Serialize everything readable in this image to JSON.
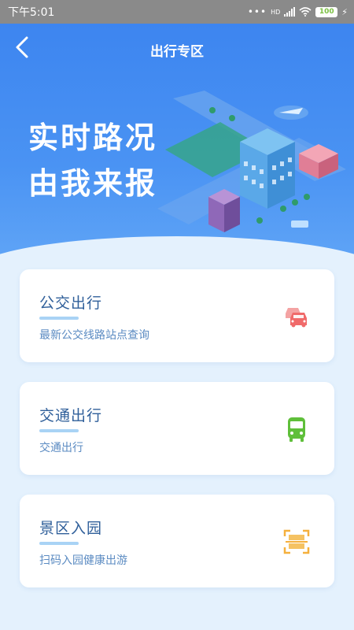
{
  "status_bar": {
    "time": "下午5:01",
    "signal_label": "HD",
    "battery": "100"
  },
  "nav": {
    "title": "出行专区"
  },
  "hero": {
    "line1": "实时路况",
    "line2": "由我来报"
  },
  "cards": [
    {
      "title": "公交出行",
      "subtitle": "最新公交线路站点查询",
      "icon": "cars-icon",
      "icon_color": "#f06a6a"
    },
    {
      "title": "交通出行",
      "subtitle": "交通出行",
      "icon": "bus-icon",
      "icon_color": "#5fbf3a"
    },
    {
      "title": "景区入园",
      "subtitle": "扫码入园健康出游",
      "icon": "scan-icon",
      "icon_color": "#f5b03d"
    }
  ],
  "colors": {
    "hero_blue": "#3d85f0",
    "background": "#e4f1fd",
    "title_text": "#2f5f9a"
  }
}
